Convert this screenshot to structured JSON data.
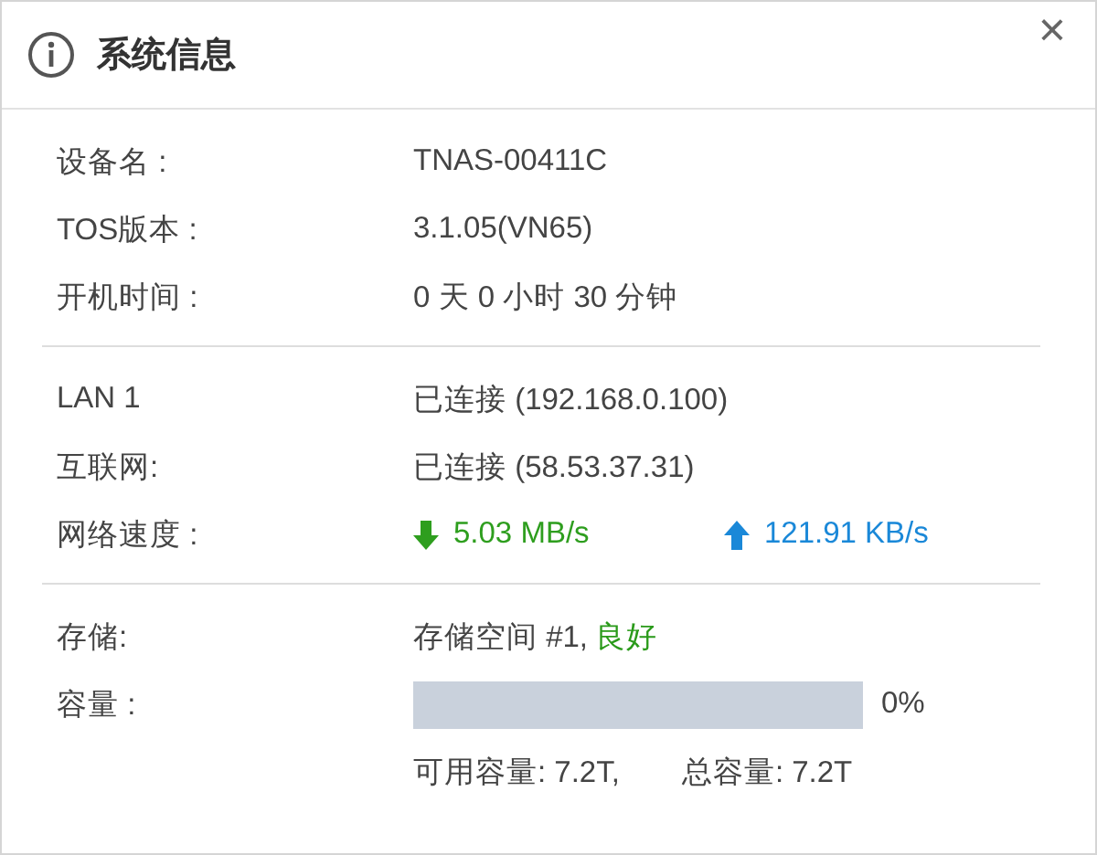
{
  "window": {
    "title": "系统信息",
    "close": "×"
  },
  "sections": [
    {
      "rows": [
        {
          "kind": "text",
          "label": "设备名 :",
          "value": "TNAS-00411C"
        },
        {
          "kind": "text",
          "label": "TOS版本 :",
          "value": "3.1.05(VN65)"
        },
        {
          "kind": "text",
          "label": "开机时间 :",
          "value": "0 天 0 小时 30 分钟"
        }
      ]
    },
    {
      "rows": [
        {
          "kind": "text",
          "label": "LAN 1",
          "value": "已连接 (192.168.0.100)"
        },
        {
          "kind": "text",
          "label": "互联网:",
          "value": "已连接 (58.53.37.31)"
        },
        {
          "kind": "speed",
          "label": "网络速度 :",
          "down": "5.03 MB/s",
          "up": "121.91 KB/s"
        }
      ]
    },
    {
      "rows": [
        {
          "kind": "status",
          "label": "存储:",
          "value": "存储空间 #1,",
          "status": "良好",
          "color": "#2a9a1a"
        },
        {
          "kind": "meter",
          "label": "容量 :",
          "level": 0,
          "reading": "0%"
        },
        {
          "kind": "pair",
          "values": [
            "可用容量: 7.2T,",
            "总容量: 7.2T"
          ]
        }
      ]
    }
  ]
}
